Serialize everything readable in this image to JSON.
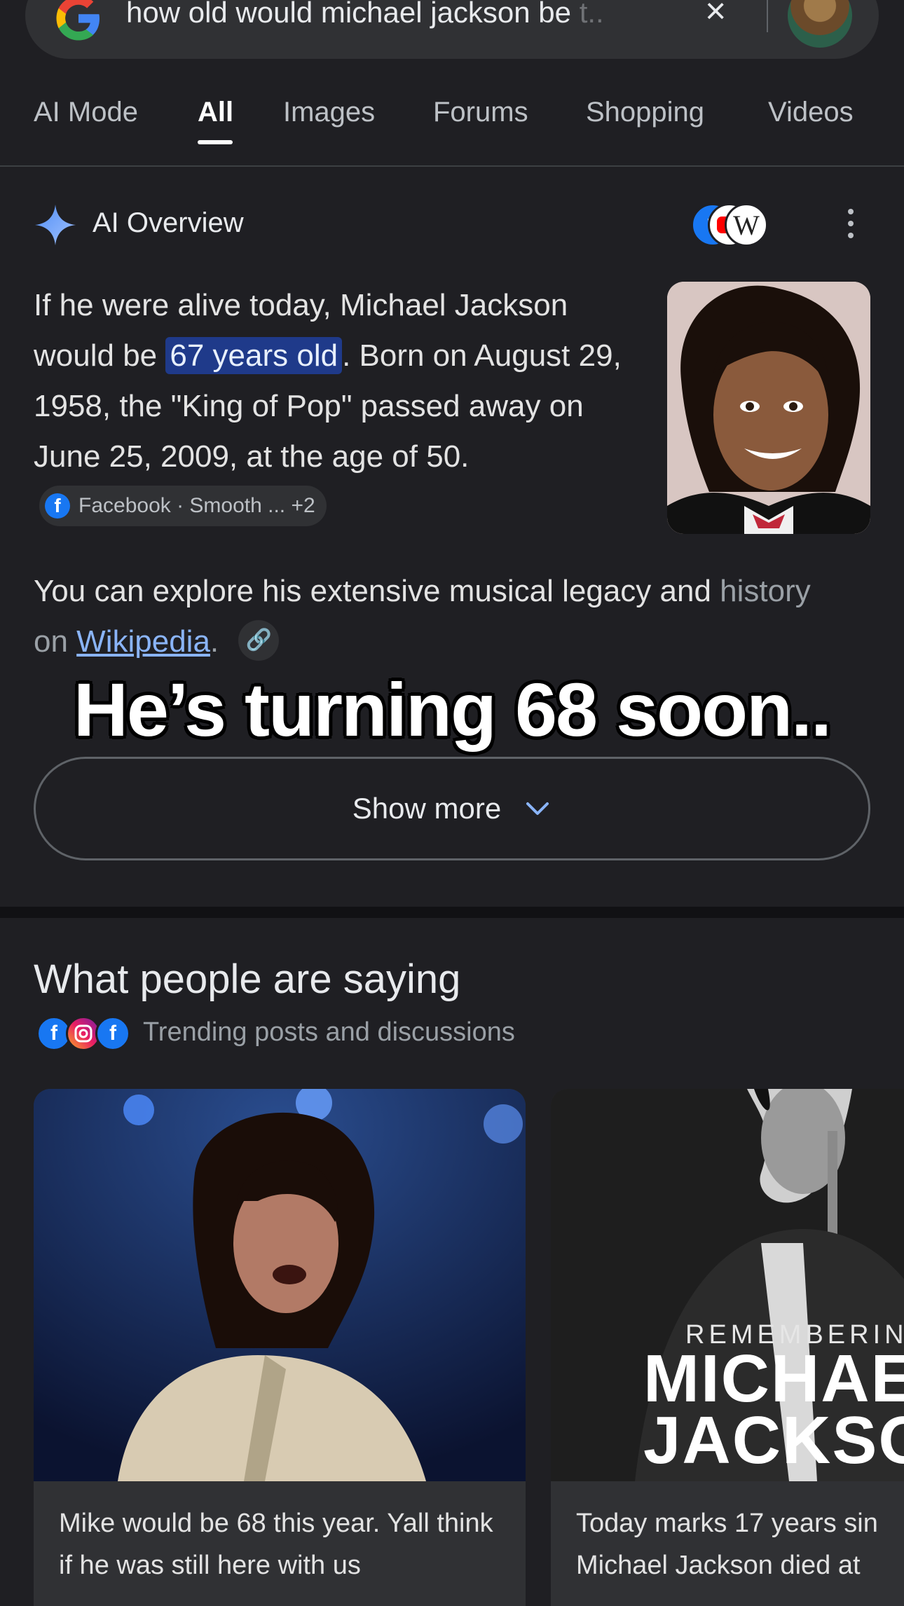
{
  "search": {
    "query_visible": "how old would michael jackson be",
    "query_faded": " t..",
    "clear_icon": "×"
  },
  "tabs": [
    {
      "label": "AI Mode",
      "active": false
    },
    {
      "label": "All",
      "active": true
    },
    {
      "label": "Images",
      "active": false
    },
    {
      "label": "Forums",
      "active": false
    },
    {
      "label": "Shopping",
      "active": false
    },
    {
      "label": "Videos",
      "active": false
    }
  ],
  "ai_overview": {
    "title": "AI Overview",
    "answer_pre": "If he were alive today, Michael Jackson would be ",
    "answer_highlight": "67 years old",
    "answer_post": ". Born on August 29, 1958, the \"King of Pop\" passed away on June 25, 2009, at the age of 50.",
    "chip_label": "Facebook · Smooth ... +2",
    "chip_icon_letter": "f",
    "explore_pre": "You can explore his extensive musical legacy and ",
    "explore_dim": "history on ",
    "explore_link": "Wikipedia",
    "explore_post": ".",
    "link_icon_glyph": "🔗",
    "show_more_label": "Show more",
    "source_icons": [
      "facebook-icon",
      "youtube-icon",
      "wikipedia-icon"
    ]
  },
  "caption": {
    "text": "He’s turning 68 soon.."
  },
  "people": {
    "title": "What people are saying",
    "subtitle": "Trending posts and discussions",
    "source_icons": [
      "facebook-icon",
      "instagram-icon",
      "facebook-icon"
    ],
    "cards": [
      {
        "text": "Mike would be 68 this year. Yall think if he was still here with us"
      },
      {
        "text": "Today marks 17 years sin Michael Jackson died at",
        "overlay_top": "REMEMBERING",
        "overlay_big": "MICHAE JACKSO"
      }
    ]
  },
  "colors": {
    "background": "#1f1f23",
    "highlight": "#1f3a8a",
    "link": "#8ab4f8",
    "facebook": "#1877f2",
    "youtube": "#ff0000"
  }
}
